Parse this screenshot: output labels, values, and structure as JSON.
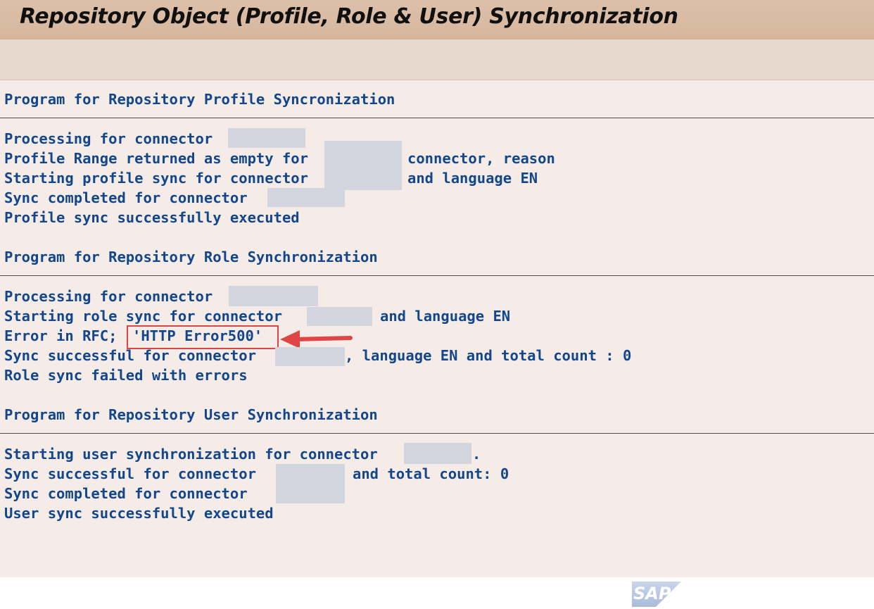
{
  "window": {
    "title": "Repository Object (Profile, Role & User) Synchronization"
  },
  "log": {
    "profile_section": {
      "heading": "Program for Repository Profile Syncronization",
      "lines": {
        "processing": "Processing for connector",
        "range_a": "Profile Range returned as empty for",
        "range_b": "connector, reason",
        "starting_a": "Starting profile sync for connector",
        "starting_b": "and language EN",
        "completed": "Sync completed for connector",
        "executed": "Profile sync successfully executed"
      }
    },
    "role_section": {
      "heading": "Program for Repository Role Synchronization",
      "lines": {
        "processing": "Processing for connector",
        "starting_a": "Starting role sync for connector",
        "starting_b": "and language EN",
        "error_prefix": "Error in RFC;",
        "error_message": "'HTTP Error500'",
        "success_a": "Sync successful for connector",
        "success_b": ", language EN and total count : 0",
        "failed": "Role sync failed with errors"
      }
    },
    "user_section": {
      "heading": "Program for Repository User Synchronization",
      "lines": {
        "starting_a": "Starting user synchronization for connector",
        "starting_b": ".",
        "success_a": "Sync successful for connector",
        "success_b": "and total count: 0",
        "completed": "Sync completed for connector",
        "executed": "User sync successfully executed"
      }
    }
  },
  "annotation": {
    "icon": "arrow-left-icon",
    "color": "#e04545"
  },
  "footer": {
    "logo": "SAP"
  },
  "colors": {
    "text": "#13468a",
    "title_bar": "#ddc0aa",
    "toolbar": "#e8d9cf",
    "content_bg": "#f5ece7",
    "redaction": "#d3d6df"
  }
}
